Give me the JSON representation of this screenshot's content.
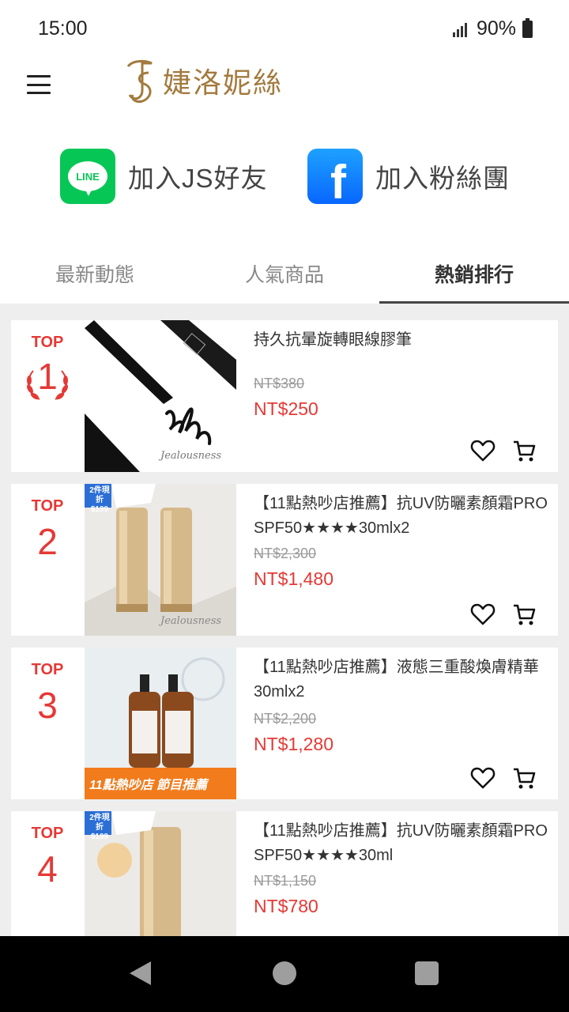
{
  "status_bar": {
    "time": "15:00",
    "battery": "90%"
  },
  "header": {
    "brand": "婕洛妮絲",
    "menu_icon": "hamburger-icon"
  },
  "social": {
    "line": {
      "icon_text": "LINE",
      "label": "加入JS好友",
      "color": "#06c755"
    },
    "facebook": {
      "icon_text": "f",
      "label": "加入粉絲團",
      "color": "#0866ff"
    }
  },
  "tabs": [
    {
      "label": "最新動態",
      "active": false
    },
    {
      "label": "人氣商品",
      "active": false
    },
    {
      "label": "熱銷排行",
      "active": true
    }
  ],
  "products": [
    {
      "rank_label": "TOP",
      "rank": "1",
      "title": "持久抗暈旋轉眼線膠筆",
      "old_price": "NT$380",
      "price": "NT$250",
      "image_text": "Jealousness",
      "image_badge": ""
    },
    {
      "rank_label": "TOP",
      "rank": "2",
      "title": "【11點熱吵店推薦】抗UV防曬素顏霜PRO SPF50★★★★30mlx2",
      "old_price": "NT$2,300",
      "price": "NT$1,480",
      "image_text": "Jealousness",
      "image_badge": "2件現折 $199"
    },
    {
      "rank_label": "TOP",
      "rank": "3",
      "title": "【11點熱吵店推薦】液態三重酸煥膚精華30mlx2",
      "old_price": "NT$2,200",
      "price": "NT$1,280",
      "image_text": "11點熱吵店 節目推薦",
      "image_badge": ""
    },
    {
      "rank_label": "TOP",
      "rank": "4",
      "title": "【11點熱吵店推薦】抗UV防曬素顏霜PRO SPF50★★★★30ml",
      "old_price": "NT$1,150",
      "price": "NT$780",
      "image_text": "",
      "image_badge": "2件現折 $199"
    }
  ],
  "colors": {
    "accent_red": "#e53935",
    "brand_gold": "#a37a3e",
    "background": "#eeeeee"
  },
  "icons": {
    "favorite": "heart-outline-icon",
    "cart": "shopping-cart-icon",
    "back": "back-triangle-icon",
    "home": "home-circle-icon",
    "recents": "recents-square-icon"
  }
}
